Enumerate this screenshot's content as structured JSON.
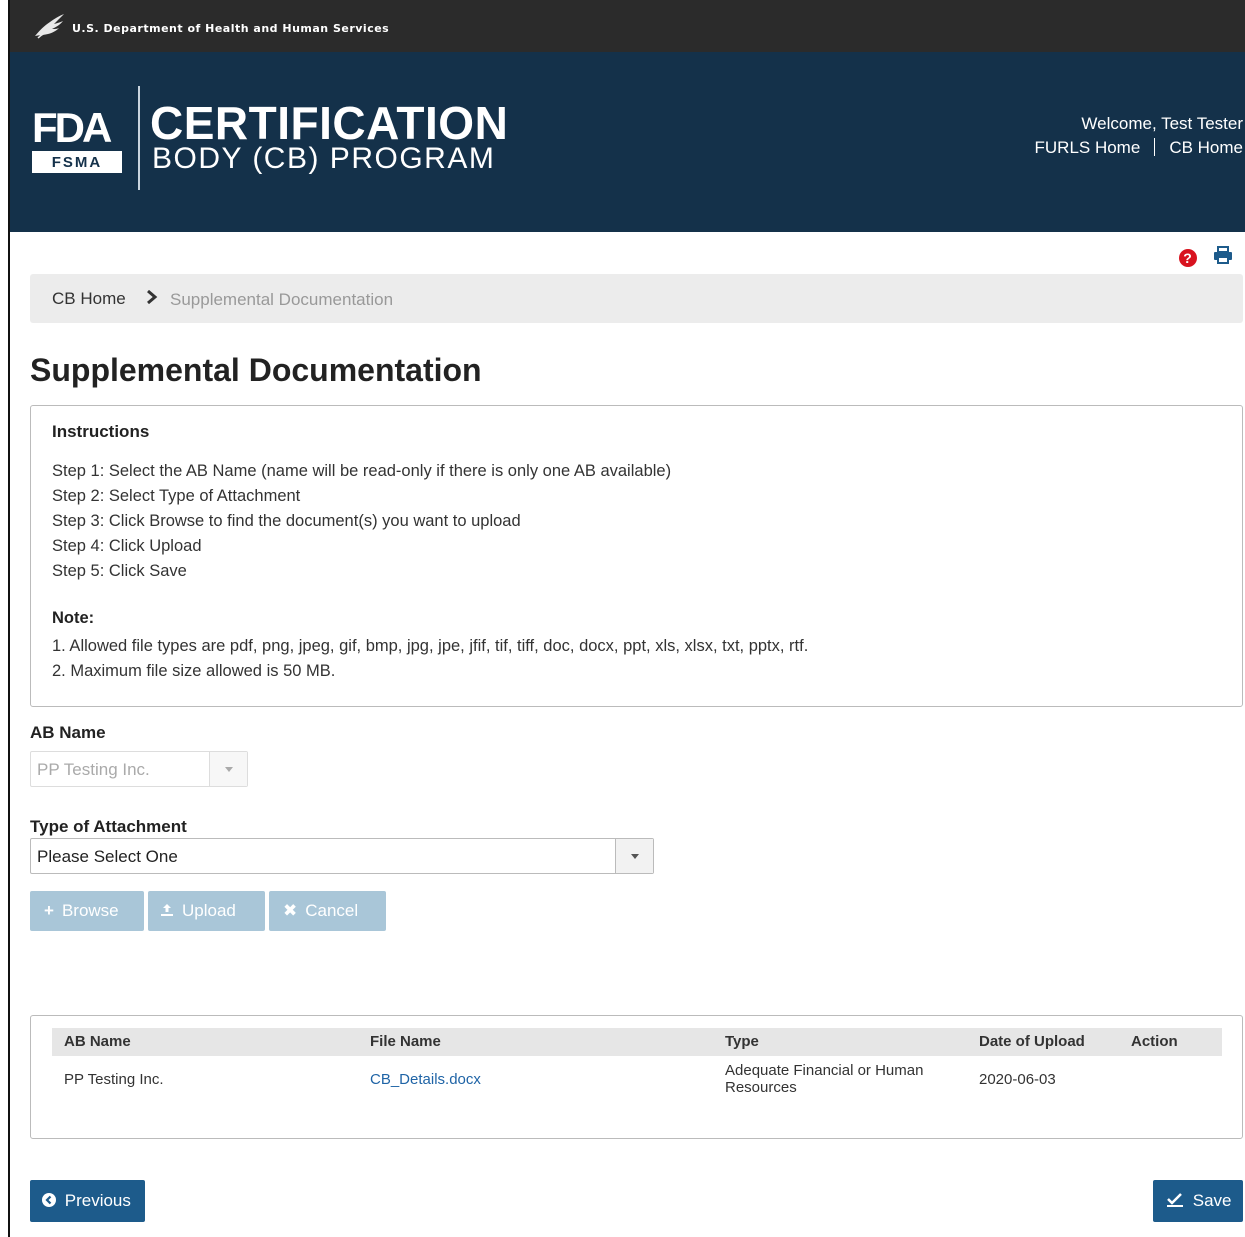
{
  "topbar": {
    "agency": "U.S. Department of Health and Human Services"
  },
  "header": {
    "logo_text": "FDA",
    "logo_sub": "FSMA",
    "title_line1": "CERTIFICATION",
    "title_line2": "BODY (CB) PROGRAM",
    "welcome": "Welcome, Test Tester",
    "links": [
      "FURLS Home",
      "CB Home"
    ]
  },
  "breadcrumb": {
    "home": "CB Home",
    "current": "Supplemental Documentation"
  },
  "page": {
    "title": "Supplemental Documentation"
  },
  "instructions": {
    "heading": "Instructions",
    "steps": [
      "Step 1: Select the AB Name (name will be read-only if there is only one AB available)",
      "Step 2: Select Type of Attachment",
      "Step 3: Click Browse to find the document(s) you want to upload",
      "Step 4: Click Upload",
      "Step 5: Click Save"
    ],
    "note_heading": "Note:",
    "notes": [
      "1. Allowed file types are pdf, png, jpeg, gif, bmp, jpg, jpe, jfif, tif, tiff, doc, docx, ppt, xls, xlsx, txt, pptx, rtf.",
      "2. Maximum file size allowed is 50 MB."
    ]
  },
  "form": {
    "ab_name_label": "AB Name",
    "ab_name_value": "PP Testing Inc.",
    "type_label": "Type of Attachment",
    "type_value": "Please Select One"
  },
  "buttons": {
    "browse": "Browse",
    "upload": "Upload",
    "cancel": "Cancel",
    "previous": "Previous",
    "save": "Save"
  },
  "table": {
    "headers": [
      "AB Name",
      "File Name",
      "Type",
      "Date of Upload",
      "Action"
    ],
    "rows": [
      {
        "ab_name": "PP Testing Inc.",
        "file_name": "CB_Details.docx",
        "type_line1": "Adequate Financial or Human",
        "type_line2": "Resources",
        "date": "2020-06-03",
        "action": ""
      }
    ]
  },
  "colors": {
    "banner": "#14314a",
    "primary_button": "#1d5b8b",
    "disabled_button": "#a9c6d8",
    "link": "#1f64a6",
    "help": "#d8131f"
  }
}
